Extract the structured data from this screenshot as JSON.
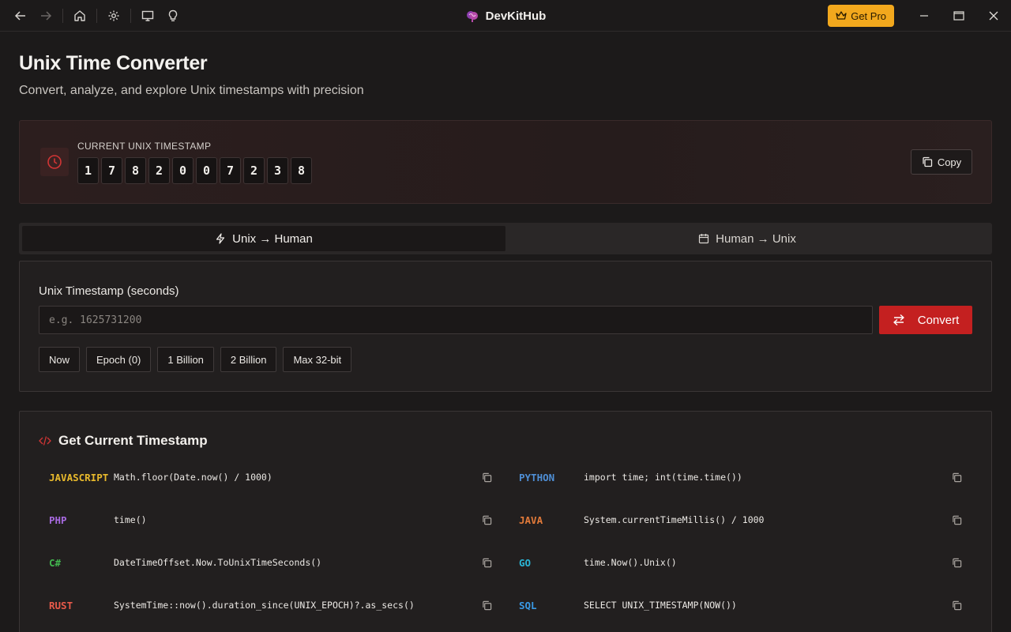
{
  "titlebar": {
    "app_name": "DevKitHub",
    "get_pro_label": "Get Pro",
    "nav_icons": [
      "arrow-left-icon",
      "arrow-right-icon",
      "home-icon",
      "gear-icon",
      "monitor-icon",
      "lightbulb-icon"
    ]
  },
  "header": {
    "title": "Unix Time Converter",
    "subtitle": "Convert, analyze, and explore Unix timestamps with precision"
  },
  "current": {
    "label": "CURRENT UNIX TIMESTAMP",
    "digits": [
      "1",
      "7",
      "8",
      "2",
      "0",
      "0",
      "7",
      "2",
      "3",
      "8"
    ],
    "copy_label": "Copy"
  },
  "tabs": [
    {
      "label": "Unix → Human",
      "icon": "lightning-icon",
      "active": true
    },
    {
      "label": "Human → Unix",
      "icon": "calendar-icon",
      "active": false
    }
  ],
  "converter": {
    "input_label": "Unix Timestamp (seconds)",
    "input_placeholder": "e.g. 1625731200",
    "input_value": "",
    "convert_label": "Convert",
    "presets": [
      "Now",
      "Epoch (0)",
      "1 Billion",
      "2 Billion",
      "Max 32-bit"
    ]
  },
  "snippets": {
    "title": "Get Current Timestamp",
    "items": [
      {
        "lang": "JAVASCRIPT",
        "code": "Math.floor(Date.now() / 1000)",
        "color": "#e8b92c"
      },
      {
        "lang": "PYTHON",
        "code": "import time; int(time.time())",
        "color": "#4f8fd6"
      },
      {
        "lang": "PHP",
        "code": "time()",
        "color": "#a86ae0"
      },
      {
        "lang": "JAVA",
        "code": "System.currentTimeMillis() / 1000",
        "color": "#e27a3a"
      },
      {
        "lang": "C#",
        "code": "DateTimeOffset.Now.ToUnixTimeSeconds()",
        "color": "#43b84f"
      },
      {
        "lang": "GO",
        "code": "time.Now().Unix()",
        "color": "#2bb6d6"
      },
      {
        "lang": "RUST",
        "code": "SystemTime::now().duration_since(UNIX_EPOCH)?.as_secs()",
        "color": "#e85a4a"
      },
      {
        "lang": "SQL",
        "code": "SELECT UNIX_TIMESTAMP(NOW())",
        "color": "#3a9ae6"
      }
    ]
  },
  "colors": {
    "accent": "#c42020",
    "pro": "#f2a81d",
    "background": "#1c1a1a"
  }
}
